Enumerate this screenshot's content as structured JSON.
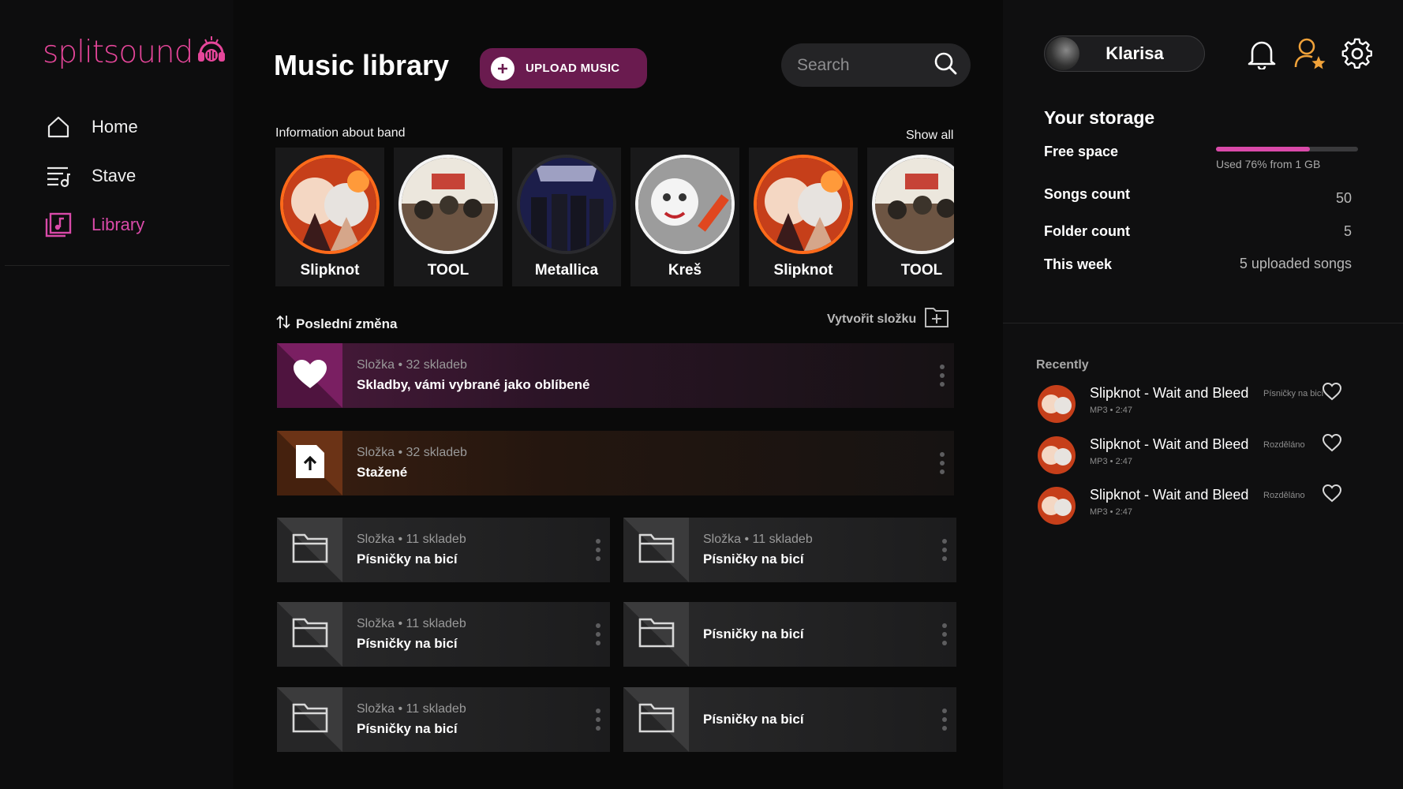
{
  "app": {
    "logo": "splitsound"
  },
  "sidebar": {
    "items": [
      {
        "label": "Home",
        "icon": "home-icon",
        "active": false
      },
      {
        "label": "Stave",
        "icon": "queue-music-icon",
        "active": false
      },
      {
        "label": "Library",
        "icon": "music-library-icon",
        "active": true
      }
    ]
  },
  "header": {
    "title": "Music library",
    "upload_label": "UPLOAD MUSIC",
    "search_placeholder": "Search"
  },
  "bands": {
    "section_label": "Information about band",
    "show_all": "Show all",
    "items": [
      {
        "name": "Slipknot",
        "style": "orange"
      },
      {
        "name": "TOOL",
        "style": "white"
      },
      {
        "name": "Metallica",
        "style": "dark"
      },
      {
        "name": "Kreš",
        "style": "white"
      },
      {
        "name": "Slipknot",
        "style": "orange"
      },
      {
        "name": "TOOL",
        "style": "white"
      }
    ]
  },
  "library": {
    "sort_label": "Poslední změna",
    "create_folder": "Vytvořit složku",
    "favorites": {
      "sub": "Složka • 32 skladeb",
      "title": "Skladby, vámi vybrané jako oblíbené"
    },
    "downloads": {
      "sub": "Složka • 32 skladeb",
      "title": "Stažené"
    },
    "folders": [
      {
        "sub": "Složka • 11 skladeb",
        "title": "Písničky na bicí"
      },
      {
        "sub": "Složka • 11 skladeb",
        "title": "Písničky na bicí"
      },
      {
        "sub": "Složka • 11 skladeb",
        "title": "Písničky na bicí"
      },
      {
        "sub": "",
        "title": "Písničky na bicí"
      },
      {
        "sub": "Složka • 11 skladeb",
        "title": "Písničky na bicí"
      },
      {
        "sub": "",
        "title": "Písničky na bicí"
      }
    ]
  },
  "user": {
    "name": "Klarisa"
  },
  "storage": {
    "title": "Your storage",
    "free_space_label": "Free space",
    "used_fraction": 0.66,
    "used_note": "Used 76% from 1 GB",
    "songs_label": "Songs count",
    "songs_value": "50",
    "folders_label": "Folder count",
    "folders_value": "5",
    "week_label": "This week",
    "week_value": "5 uploaded songs"
  },
  "recently": {
    "title": "Recently",
    "items": [
      {
        "title": "Slipknot -  Wait and Bleed",
        "meta": "MP3 • 2:47",
        "tag": "Písničky na bicí"
      },
      {
        "title": "Slipknot -  Wait and Bleed",
        "meta": "MP3 • 2:47",
        "tag": "Rozděláno"
      },
      {
        "title": "Slipknot -  Wait and Bleed",
        "meta": "MP3 • 2:47",
        "tag": "Rozděláno"
      }
    ]
  },
  "colors": {
    "accent": "#d94aa9",
    "upload_bg": "#6a1b4f",
    "band_ring": "#ff6a1a",
    "star": "#f0a23a"
  }
}
